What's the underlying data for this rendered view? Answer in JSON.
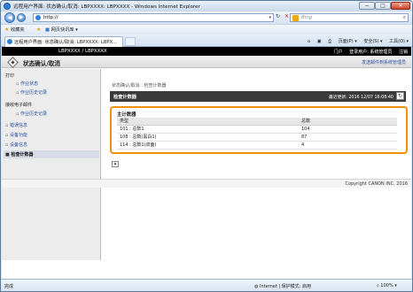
{
  "window": {
    "title": "远程用户界面: 状态确认/取消: LBPXXXX: LBPXXXX - Windows Internet Explorer",
    "controls": [
      "−",
      "□",
      "✕"
    ]
  },
  "address_bar": {
    "url": "http://",
    "search_placeholder": "Bing"
  },
  "favorites_bar": {
    "favorites_label": "收藏夹",
    "suggested_sites_label": "网页快讯库 ▾"
  },
  "tab": {
    "label": "远程用户界面: 状态确认/取消: LBPXXXX: LBPX..."
  },
  "command_bar": {
    "page": "页面(P) ▾",
    "safety": "安全(S) ▾",
    "tools": "工具(O) ▾",
    "help": "❷ ▾"
  },
  "page": {
    "product": "LBPXXXX / LBPXXXX",
    "top_links": {
      "portal": "门户",
      "login_user": "登录用户: 系统管理员",
      "logout": "注销"
    },
    "heading": "状态确认/取消",
    "send_email": "发送邮件到系统管理员",
    "sidebar": {
      "print_section": "打印",
      "job_status": "作业状态",
      "job_log": "作业历史记录",
      "fax_section": "接收电子邮件",
      "fax_job_log": "作业历史记录",
      "error_info": "错误信息",
      "device_features": "设备功能",
      "device_info": "设备信息",
      "counter_check": "检查计数器"
    },
    "breadcrumb": "状态确认/取消 : 检查计数器",
    "panel": {
      "title": "检查计数器",
      "last_updated": "最近更新: 2016 12/07 16:08:40"
    },
    "counter": {
      "title": "主计数器",
      "headers": [
        "类型",
        "总数"
      ],
      "rows": [
        {
          "type": "101 : 总数1",
          "total": "104"
        },
        {
          "type": "108 : 总数(黑白1)",
          "total": "87"
        },
        {
          "type": "114 : 总数1(双面)",
          "total": "4"
        }
      ]
    },
    "copyright": "Copyright CANON INC. 2016"
  },
  "status_bar": {
    "left": "完成",
    "zone": "Internet | 保护模式: 启用",
    "zoom": "100%"
  },
  "colors": {
    "highlight_border": "#f0900c",
    "header_black": "#000000",
    "panel_bar": "#3a3a3a"
  }
}
